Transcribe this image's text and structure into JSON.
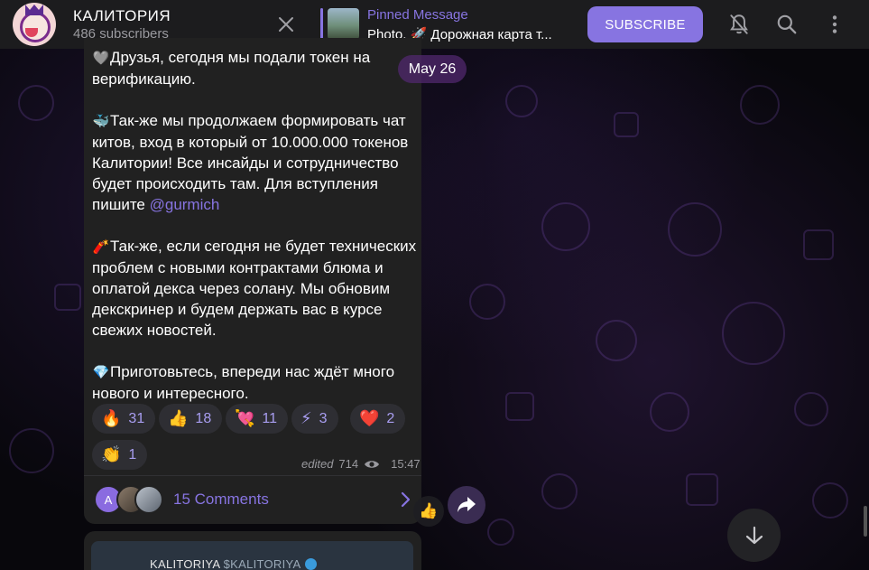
{
  "header": {
    "channel_name": "КАЛИТОРИЯ",
    "subscribers": "486 subscribers",
    "pinned_label": "Pinned Message",
    "pinned_text": "Photo, 🚀 Дорожная карта т...",
    "subscribe_label": "SUBSCRIBE",
    "icons": [
      "close-icon",
      "mute-bell-icon",
      "search-icon",
      "more-vertical-icon"
    ]
  },
  "date_pill": "May 26",
  "message": {
    "para1_emoji": "🩶",
    "para1": "Друзья, сегодня мы подали токен на верификацию.",
    "para2_emoji": "🐳",
    "para2": "Так-же мы продолжаем формировать чат китов, вход в который от 10.000.000 токенов Калитории! Все инсайды и сотрудничество будет происходить там. Для вступления пишите ",
    "para2_link": "@gurmich",
    "para3_emoji": "🧨",
    "para3": "Так-же, если сегодня не будет технических проблем с новыми контрактами блюма и оплатой декса через солану. Мы обновим декскринер и будем держать вас в курсе свежих новостей.",
    "para4_emoji": "💎",
    "para4": "Приготовьтесь, впереди нас ждёт много нового и интересного.",
    "reactions": [
      {
        "emoji": "🔥",
        "count": "31"
      },
      {
        "emoji": "👍",
        "count": "18"
      },
      {
        "emoji": "💘",
        "count": "11"
      },
      {
        "emoji": "⚡",
        "count": "3"
      },
      {
        "emoji": "❤️",
        "count": "2"
      },
      {
        "emoji": "👏",
        "count": "1"
      }
    ],
    "edited": "edited",
    "views": "714",
    "time": "15:47",
    "comments_label": "15 Comments",
    "comment_avatar_letter": "A"
  },
  "side_reaction": "👍",
  "next_message": {
    "title": "KALITORIYA",
    "ticker": "$KALITORIYA"
  },
  "colors": {
    "accent": "#8774e1",
    "bubble": "#212121",
    "header": "#1c1c1e"
  }
}
